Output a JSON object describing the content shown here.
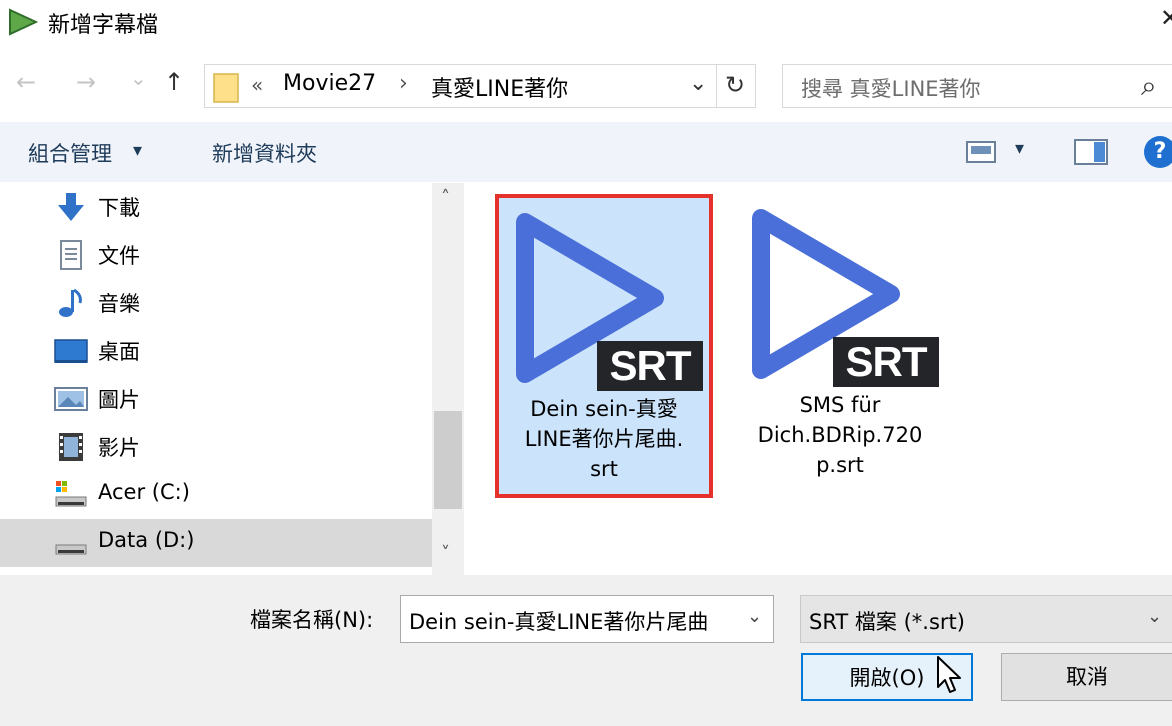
{
  "window": {
    "title": "新增字幕檔",
    "close_glyph": "✕"
  },
  "nav": {
    "back": "←",
    "forward": "→",
    "recent": "⌄",
    "up": "↑",
    "breadcrumb_prefix": "«",
    "breadcrumb": [
      "Movie27",
      "真愛LINE著你"
    ],
    "breadcrumb_sep": "›",
    "dropdown": "⌄",
    "refresh": "↻",
    "search_placeholder": "搜尋 真愛LINE著你",
    "search_icon": "⌕"
  },
  "toolbar": {
    "organize": "組合管理",
    "organize_arrow": "▾",
    "new_folder": "新增資料夾",
    "view_arrow": "▾",
    "help": "?"
  },
  "sidebar": {
    "items": [
      {
        "label": "下載",
        "icon": "download-icon"
      },
      {
        "label": "文件",
        "icon": "document-icon"
      },
      {
        "label": "音樂",
        "icon": "music-icon"
      },
      {
        "label": "桌面",
        "icon": "desktop-icon"
      },
      {
        "label": "圖片",
        "icon": "pictures-icon"
      },
      {
        "label": "影片",
        "icon": "videos-icon"
      },
      {
        "label": "Acer (C:)",
        "icon": "drive-c-icon"
      },
      {
        "label": "Data (D:)",
        "icon": "drive-d-icon",
        "selected": true
      }
    ],
    "scroll_up": "˄",
    "scroll_down": "˅"
  },
  "files": [
    {
      "name_lines": [
        "Dein sein-真愛",
        "LINE著你片尾曲.",
        "srt"
      ],
      "badge": "SRT",
      "selected": true
    },
    {
      "name_lines": [
        "SMS für",
        "Dich.BDRip.720",
        "p.srt"
      ],
      "badge": "SRT",
      "selected": false
    }
  ],
  "bottom": {
    "filename_label": "檔案名稱(N):",
    "filename_value": "Dein sein-真愛LINE著你片尾曲",
    "filter_value": "SRT 檔案 (*.srt)",
    "open_label": "開啟(O)",
    "cancel_label": "取消"
  },
  "colors": {
    "play_blue": "#4a6fd8",
    "selection_fill": "#cce4fb",
    "highlight_box": "#e5312b",
    "badge_bg": "#232528"
  }
}
